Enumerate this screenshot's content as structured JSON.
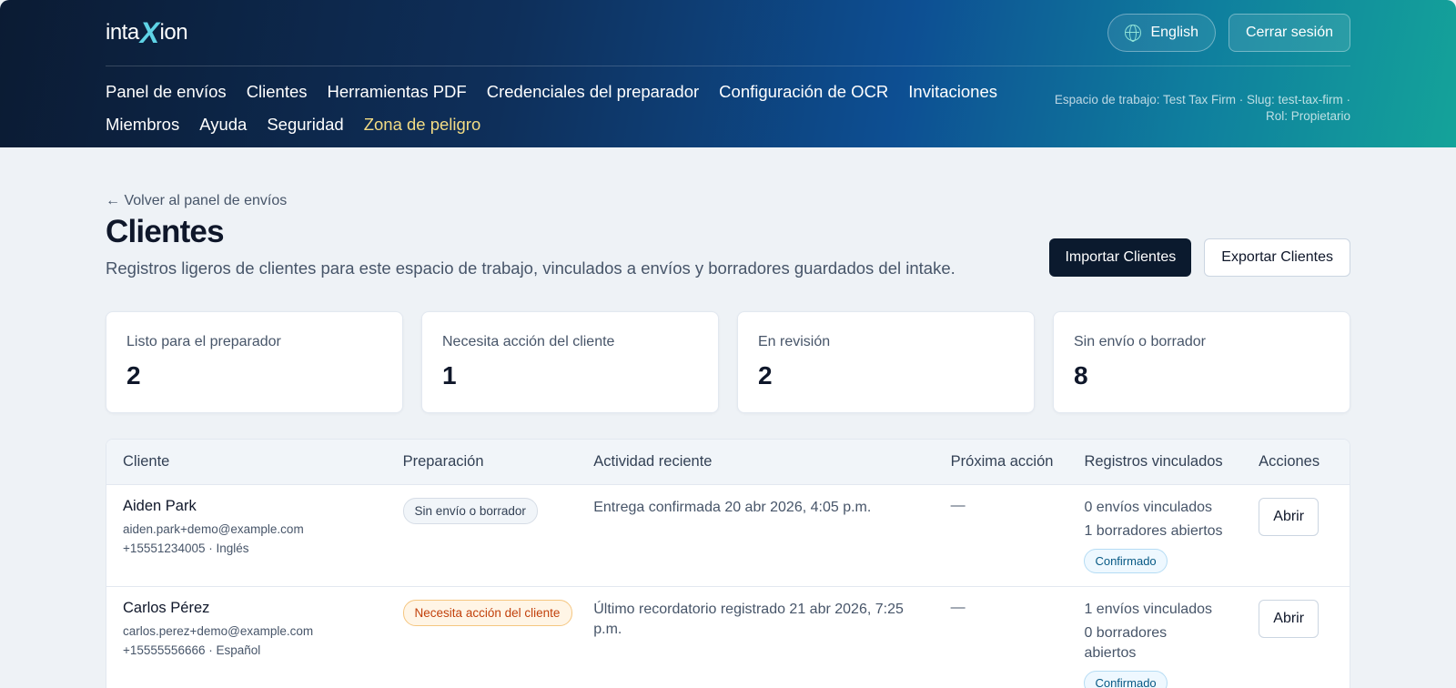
{
  "brand": {
    "logo_pre": "inta",
    "logo_x": "X",
    "logo_post": "ion"
  },
  "header": {
    "language_label": "English",
    "logout_label": "Cerrar sesión",
    "nav": [
      {
        "label": "Panel de envíos"
      },
      {
        "label": "Clientes"
      },
      {
        "label": "Herramientas PDF"
      },
      {
        "label": "Credenciales del preparador"
      },
      {
        "label": "Configuración de OCR"
      },
      {
        "label": "Invitaciones"
      },
      {
        "label": "Miembros"
      },
      {
        "label": "Ayuda"
      },
      {
        "label": "Seguridad"
      },
      {
        "label": "Zona de peligro"
      }
    ],
    "workspace_info": "Espacio de trabajo: Test Tax Firm · Slug: test-tax-firm · Rol: Propietario"
  },
  "page": {
    "back_link": "← Volver al panel de envíos",
    "title": "Clientes",
    "subtitle": "Registros ligeros de clientes para este espacio de trabajo, vinculados a envíos y borradores guardados del intake.",
    "import_label": "Importar Clientes",
    "export_label": "Exportar Clientes"
  },
  "stats": [
    {
      "label": "Listo para el preparador",
      "value": "2"
    },
    {
      "label": "Necesita acción del cliente",
      "value": "1"
    },
    {
      "label": "En revisión",
      "value": "2"
    },
    {
      "label": "Sin envío o borrador",
      "value": "8"
    }
  ],
  "table": {
    "headers": [
      "Cliente",
      "Preparación",
      "Actividad reciente",
      "Próxima acción",
      "Registros vinculados",
      "Acciones"
    ],
    "rows": [
      {
        "name": "Aiden Park",
        "email": "aiden.park+demo@example.com",
        "phone_lang": "+15551234005 · Inglés",
        "status": "Sin envío o borrador",
        "activity": "Entrega confirmada 20 abr 2026, 4:05 p.m.",
        "next_action": "—",
        "submissions": "0 envíos vinculados",
        "drafts": "1 borradores abiertos",
        "badge": "Confirmado",
        "action": "Abrir"
      },
      {
        "name": "Carlos Pérez",
        "email": "carlos.perez+demo@example.com",
        "phone_lang": "+15555556666 · Español",
        "status": "Necesita acción del cliente",
        "activity": "Último recordatorio registrado 21 abr 2026, 7:25 p.m.",
        "next_action": "—",
        "submissions": "1 envíos vinculados",
        "drafts": "0 borradores abiertos",
        "badge": "Confirmado",
        "action": "Abrir"
      }
    ]
  }
}
